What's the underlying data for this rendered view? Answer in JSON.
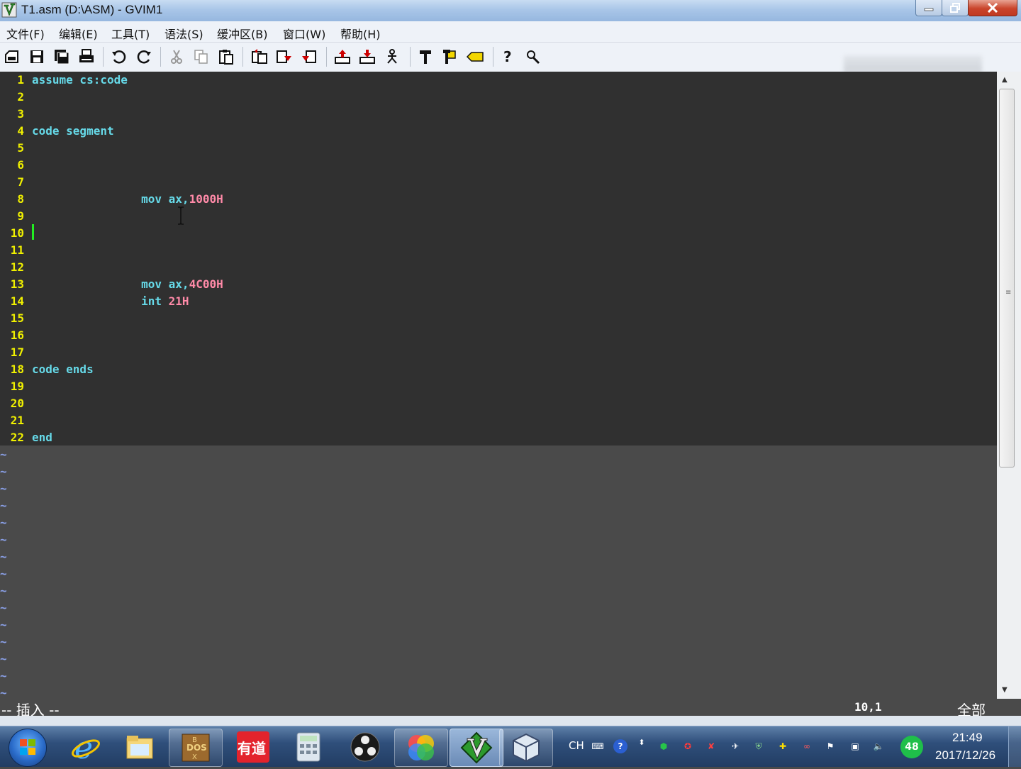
{
  "window": {
    "title": "T1.asm (D:\\ASM) - GVIM1",
    "controls": [
      "minimize-icon",
      "maximize-icon",
      "close-icon"
    ]
  },
  "menu": [
    {
      "label": "文件(F)"
    },
    {
      "label": "编辑(E)"
    },
    {
      "label": "工具(T)"
    },
    {
      "label": "语法(S)"
    },
    {
      "label": "缓冲区(B)"
    },
    {
      "label": "窗口(W)"
    },
    {
      "label": "帮助(H)"
    }
  ],
  "toolbar": [
    "open-icon",
    "save-icon",
    "save-all-icon",
    "print-icon",
    "undo-icon",
    "redo-icon",
    "cut-icon",
    "copy-icon",
    "paste-icon",
    "find-replace-icon",
    "find-next-icon",
    "find-prev-icon",
    "load-session-icon",
    "save-session-icon",
    "run-script-icon",
    "make-icon",
    "build-tags-icon",
    "jump-tag-icon",
    "help-icon",
    "find-help-icon"
  ],
  "editor": {
    "lines": [
      {
        "n": "1",
        "parts": [
          {
            "t": "assume cs:code",
            "c": "kw"
          }
        ]
      },
      {
        "n": "2",
        "parts": []
      },
      {
        "n": "3",
        "parts": []
      },
      {
        "n": "4",
        "parts": [
          {
            "t": "code segment",
            "c": "kw"
          }
        ]
      },
      {
        "n": "5",
        "parts": []
      },
      {
        "n": "6",
        "parts": []
      },
      {
        "n": "7",
        "parts": []
      },
      {
        "n": "8",
        "parts": [
          {
            "t": "                mov ax,",
            "c": "kw"
          },
          {
            "t": "1000H",
            "c": "num"
          }
        ]
      },
      {
        "n": "9",
        "parts": []
      },
      {
        "n": "10",
        "parts": []
      },
      {
        "n": "11",
        "parts": []
      },
      {
        "n": "12",
        "parts": []
      },
      {
        "n": "13",
        "parts": [
          {
            "t": "                mov ax,",
            "c": "kw"
          },
          {
            "t": "4C00H",
            "c": "num"
          }
        ]
      },
      {
        "n": "14",
        "parts": [
          {
            "t": "                int ",
            "c": "kw"
          },
          {
            "t": "21H",
            "c": "num"
          }
        ]
      },
      {
        "n": "15",
        "parts": []
      },
      {
        "n": "16",
        "parts": []
      },
      {
        "n": "17",
        "parts": []
      },
      {
        "n": "18",
        "parts": [
          {
            "t": "code ends",
            "c": "kw"
          }
        ]
      },
      {
        "n": "19",
        "parts": []
      },
      {
        "n": "20",
        "parts": []
      },
      {
        "n": "21",
        "parts": []
      },
      {
        "n": "22",
        "parts": [
          {
            "t": "end",
            "c": "kw"
          }
        ]
      }
    ],
    "tilde_char": "~",
    "tilde_count": 15,
    "cursor_line": "10"
  },
  "statusline": {
    "mode": "-- 插入 --",
    "position": "10,1",
    "percent": "全部"
  },
  "taskbar": {
    "apps": [
      {
        "name": "ie-icon"
      },
      {
        "name": "explorer-icon"
      },
      {
        "name": "dosbox-icon"
      },
      {
        "name": "youdao-icon",
        "label": "有道"
      },
      {
        "name": "calculator-icon"
      },
      {
        "name": "obs-icon"
      },
      {
        "name": "color-picker-icon"
      },
      {
        "name": "gvim-icon"
      },
      {
        "name": "virtualbox-icon"
      }
    ],
    "ime": "CH",
    "badge": "48",
    "time": "21:49",
    "date": "2017/12/26"
  },
  "colors": {
    "editor_bg": "#303030",
    "line_number": "#f0f000",
    "keyword": "#66d9e8",
    "number": "#ff8aa8",
    "cursor": "#22ee22"
  }
}
